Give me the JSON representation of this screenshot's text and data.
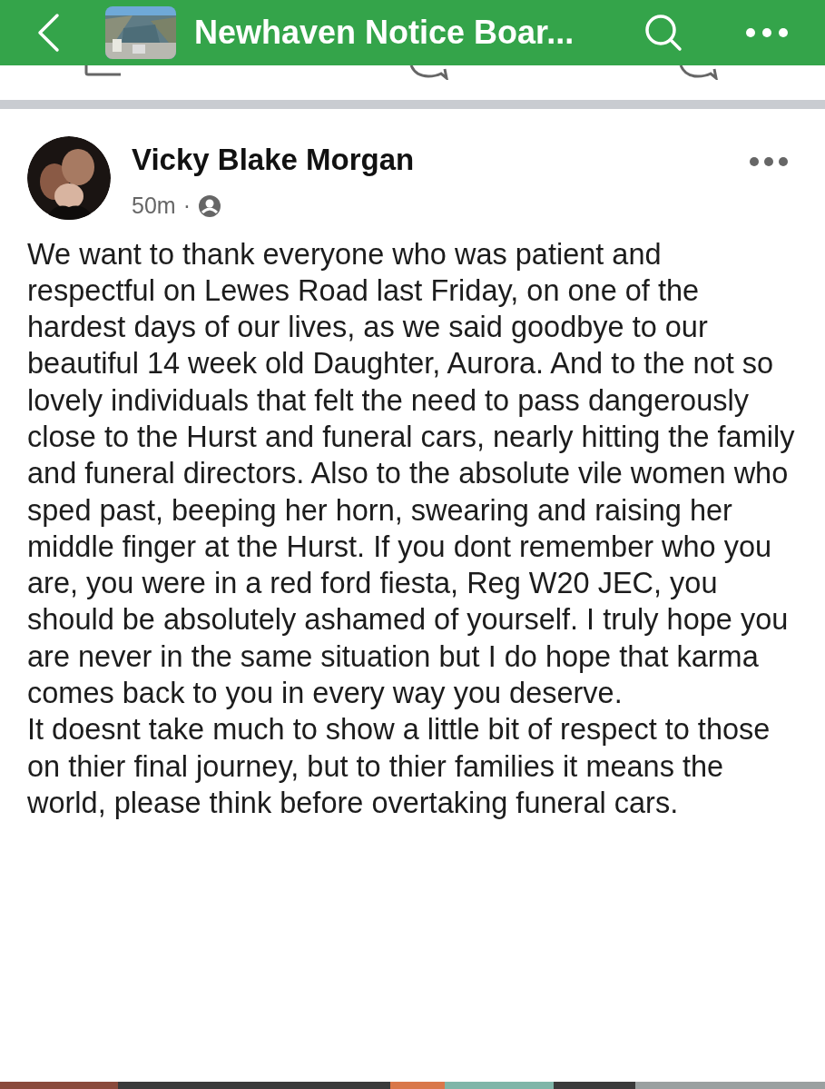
{
  "top_bar": {
    "title": "Newhaven Notice Boar..."
  },
  "post": {
    "author": "Vicky Blake Morgan",
    "time": "50m",
    "separator": "·",
    "paragraphs": [
      "We want to thank everyone who was patient and respectful on Lewes Road last Friday, on one of the hardest days of our lives, as we said goodbye to our beautiful 14 week old Daughter, Aurora. And to the not so lovely individuals that felt the need to pass dangerously close to the Hurst and funeral cars, nearly hitting the family and funeral directors. Also to the absolute vile women who sped past, beeping her horn, swearing and raising her middle finger at the Hurst. If you dont remember who you are, you were in a red ford fiesta, Reg W20 JEC, you should be absolutely ashamed of yourself. I truly hope you are never in the same situation but I do hope that karma comes back to you in every way you deserve.",
      "It doesnt take much to show a little bit of respect to those on thier final journey, but to thier families it means the world, please think before overtaking funeral cars."
    ]
  }
}
